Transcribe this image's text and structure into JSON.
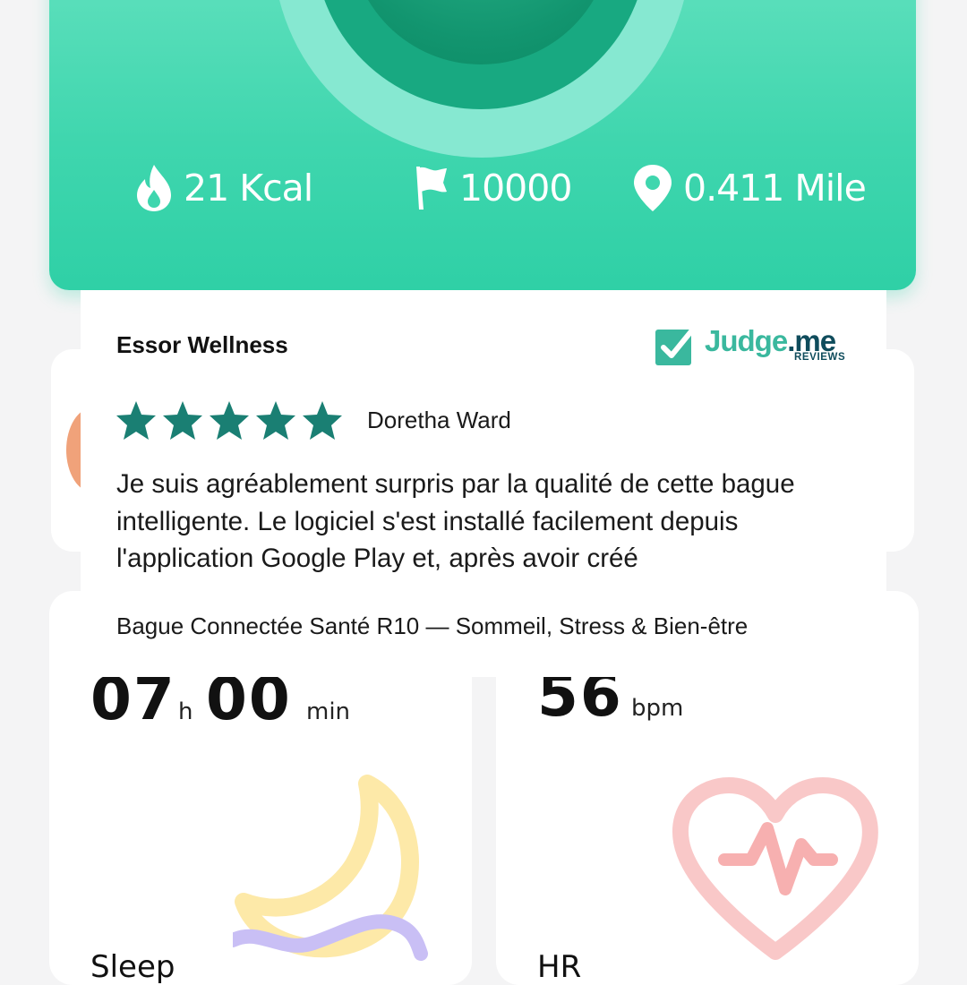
{
  "stats": {
    "kcal": "21 Kcal",
    "steps": "10000",
    "distance": "0.411 Mile"
  },
  "tiles": {
    "sleep": {
      "hours": "07",
      "hours_unit": "h",
      "minutes": "00",
      "minutes_unit": "min",
      "label": "Sleep"
    },
    "hr": {
      "value": "56",
      "unit": "bpm",
      "label": "HR"
    }
  },
  "review": {
    "shop_name": "Essor Wellness",
    "badge": {
      "brand_a": "Judge",
      "brand_b": ".me",
      "sub": "REVIEWS"
    },
    "rating": 5,
    "reviewer": "Doretha Ward",
    "body": "Je suis agréablement surpris par la qualité de cette bague intelligente. Le logiciel s'est installé facilement depuis l'application Google Play et, après avoir créé",
    "product": "Bague Connectée Santé R10 — Sommeil, Stress & Bien-être"
  },
  "colors": {
    "accent_green": "#2fd0a6",
    "star_color": "#1a7f73",
    "judgeme_teal": "#3ab89e",
    "judgeme_navy": "#0f4c5c"
  }
}
